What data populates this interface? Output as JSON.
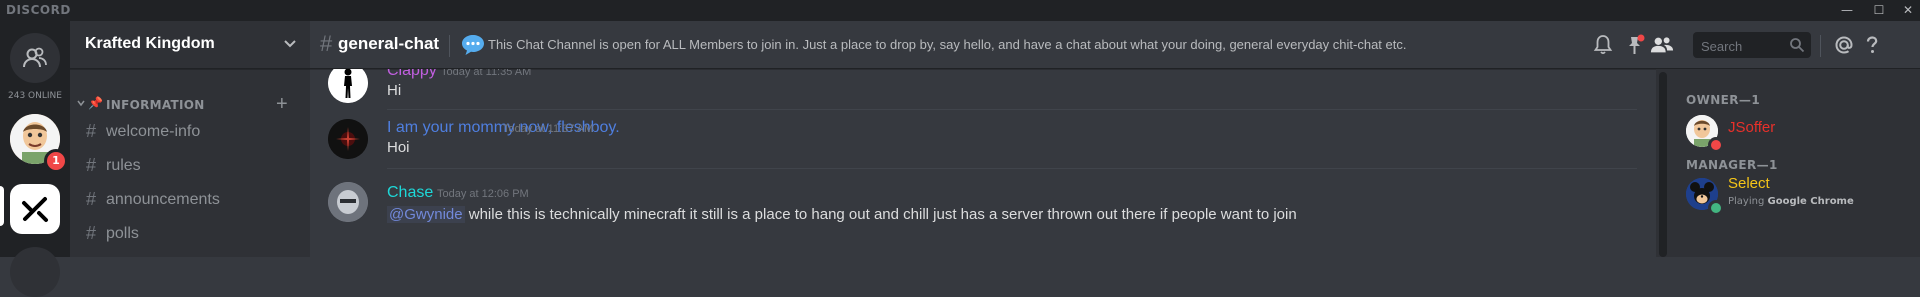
{
  "window": {
    "brand": "DISCORD",
    "controls": {
      "minimize": "—",
      "maximize": "☐",
      "close": "✕"
    }
  },
  "servers": {
    "online_count": "243 ONLINE",
    "unread_badge": "1"
  },
  "guild": {
    "name": "Krafted Kingdom",
    "category": "INFORMATION",
    "category_emoji": "📌",
    "channels": [
      {
        "name": "welcome-info"
      },
      {
        "name": "rules"
      },
      {
        "name": "announcements"
      },
      {
        "name": "polls"
      }
    ]
  },
  "channel": {
    "name": "general-chat",
    "topic": "This Chat Channel is open for ALL Members to join in. Just a place to drop by, say hello, and have a chat about what your doing, general everyday chit-chat etc."
  },
  "search": {
    "placeholder": "Search"
  },
  "messages": [
    {
      "author": "Clappy",
      "author_color": "#c15fe0",
      "timestamp": "Today at 11:35 AM",
      "text": "Hi"
    },
    {
      "author": "I am your mommy now, fleshboy.",
      "author_color": "#4f7fe0",
      "timestamp": "Today at 11:37 AM",
      "text": "Hoi"
    },
    {
      "author": "Chase",
      "author_color": "#1ed8d8",
      "timestamp": "Today at 12:06 PM",
      "mention": "@Gwynide",
      "text": " while this is technically minecraft it still is a place to hang out and chill just has a server thrown out there if people want to join"
    }
  ],
  "members": {
    "groups": [
      {
        "title": "OWNER—1",
        "members": [
          {
            "name": "JSoffer",
            "color": "#e8302a",
            "status_color": "#f04747",
            "activity_prefix": "",
            "activity_game": ""
          }
        ]
      },
      {
        "title": "MANAGER—1",
        "members": [
          {
            "name": "Select",
            "color": "#f5c518",
            "status_color": "#43b581",
            "activity_prefix": "Playing ",
            "activity_game": "Google Chrome"
          }
        ]
      }
    ]
  }
}
